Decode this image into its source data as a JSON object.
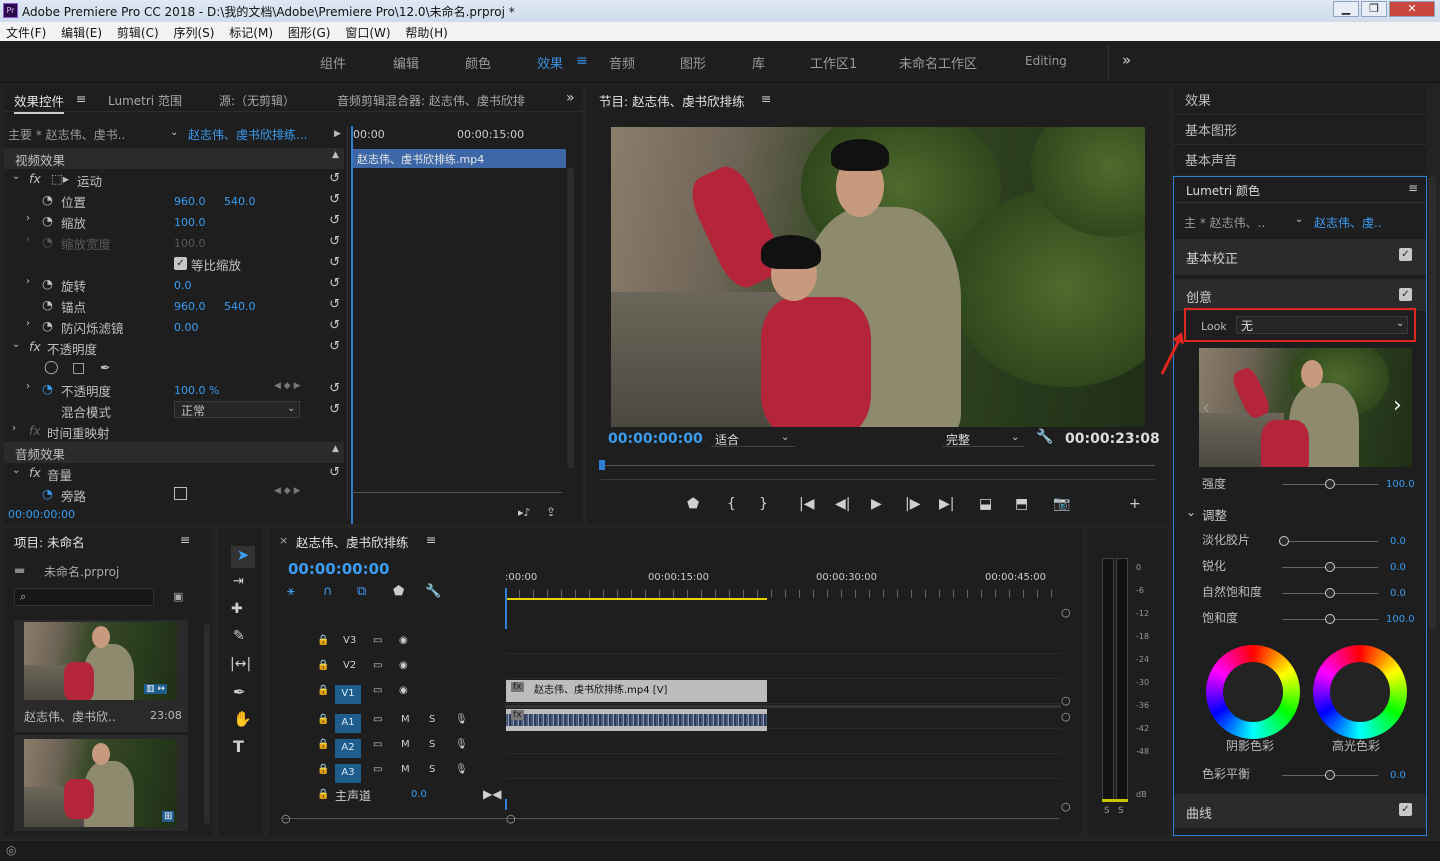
{
  "window": {
    "title": "Adobe Premiere Pro CC 2018 - D:\\我的文档\\Adobe\\Premiere Pro\\12.0\\未命名.prproj *",
    "minimize": "▁",
    "restore": "❐",
    "close": "✕"
  },
  "menu": [
    "文件(F)",
    "编辑(E)",
    "剪辑(C)",
    "序列(S)",
    "标记(M)",
    "图形(G)",
    "窗口(W)",
    "帮助(H)"
  ],
  "workspaces": [
    "组件",
    "编辑",
    "颜色",
    "效果",
    "音频",
    "图形",
    "库",
    "工作区1",
    "未命名工作区",
    "Editing"
  ],
  "active_workspace_index": 3,
  "effect_controls": {
    "tabs": [
      "效果控件",
      "Lumetri 范围",
      "源:（无剪辑）",
      "音频剪辑混合器: 赵志伟、虔书欣排"
    ],
    "master": "主要 * 赵志伟、虔书..",
    "sequence": "赵志伟、虔书欣排练...",
    "ruler_start": "00:00",
    "ruler_mid": "00:00:15:00",
    "clip_name": "赵志伟、虔书欣排练.mp4",
    "video_effects": "视频效果",
    "motion": "运动",
    "position_label": "位置",
    "position_x": "960.0",
    "position_y": "540.0",
    "scale_label": "缩放",
    "scale_value": "100.0",
    "scale_width_label": "缩放宽度",
    "scale_width_value": "100.0",
    "uniform_scale": "等比缩放",
    "rotation_label": "旋转",
    "rotation_value": "0.0",
    "anchor_label": "锚点",
    "anchor_x": "960.0",
    "anchor_y": "540.0",
    "flicker_label": "防闪烁滤镜",
    "flicker_value": "0.00",
    "opacity_group": "不透明度",
    "opacity_label": "不透明度",
    "opacity_value": "100.0 %",
    "blend_label": "混合模式",
    "blend_value": "正常",
    "time_remap": "时间重映射",
    "audio_effects": "音频效果",
    "volume": "音量",
    "bypass": "旁路",
    "timecode": "00:00:00:00"
  },
  "program": {
    "title": "节目: 赵志伟、虔书欣排练",
    "timecode": "00:00:00:00",
    "fit": "适合",
    "quality": "完整",
    "duration": "00:00:23:08"
  },
  "right_panel": {
    "items": [
      "效果",
      "基本图形",
      "基本声音"
    ],
    "lumetri_title": "Lumetri 颜色",
    "master": "主 * 赵志伟、..",
    "sequence": "赵志伟、虔..",
    "basic_correction": "基本校正",
    "creative": "创意",
    "look_label": "Look",
    "look_value": "无",
    "intensity_label": "强度",
    "intensity_value": "100.0",
    "adjust": "调整",
    "faded_film": "淡化胶片",
    "faded_film_value": "0.0",
    "sharpen": "锐化",
    "sharpen_value": "0.0",
    "vibrance": "自然饱和度",
    "vibrance_value": "0.0",
    "saturation": "饱和度",
    "saturation_value": "100.0",
    "shadow_tint": "阴影色彩",
    "highlight_tint": "高光色彩",
    "tint_balance": "色彩平衡",
    "tint_balance_value": "0.0",
    "curves": "曲线"
  },
  "project": {
    "title": "项目: 未命名",
    "file": "未命名.prproj",
    "clip_name": "赵志伟、虔书欣..",
    "clip_duration": "23:08"
  },
  "timeline": {
    "title": "赵志伟、虔书欣排练",
    "timecode": "00:00:00:00",
    "ruler": [
      ":00:00",
      "00:00:15:00",
      "00:00:30:00",
      "00:00:45:00"
    ],
    "video_tracks": [
      "V3",
      "V2",
      "V1"
    ],
    "audio_tracks": [
      "A1",
      "A2",
      "A3"
    ],
    "mute": "M",
    "solo": "S",
    "master_label": "主声道",
    "master_value": "0.0",
    "clip_label": "赵志伟、虔书欣排练.mp4 [V]"
  },
  "meter": {
    "scale": [
      "0",
      "-6",
      "-12",
      "-18",
      "-24",
      "-30",
      "-36",
      "-42",
      "-48",
      "dB"
    ],
    "solo_buttons": [
      "S",
      "S"
    ]
  }
}
